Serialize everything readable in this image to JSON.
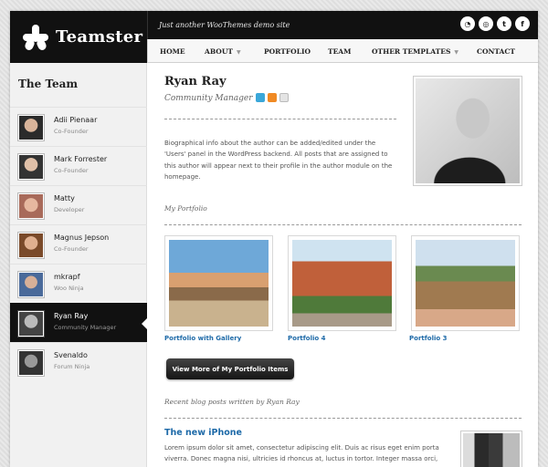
{
  "site": {
    "logo_text": "Teamster",
    "tagline": "Just another WooThemes demo site",
    "social": [
      {
        "icon": "rss-icon",
        "glyph": "◔"
      },
      {
        "icon": "dribbble-icon",
        "glyph": "◎"
      },
      {
        "icon": "twitter-icon",
        "glyph": "t"
      },
      {
        "icon": "facebook-icon",
        "glyph": "f"
      }
    ]
  },
  "nav": {
    "items": [
      {
        "label": "HOME"
      },
      {
        "label": "ABOUT",
        "has_submenu": true
      },
      {
        "label": "PORTFOLIO"
      },
      {
        "label": "TEAM"
      },
      {
        "label": "OTHER TEMPLATES",
        "has_submenu": true
      },
      {
        "label": "CONTACT"
      }
    ]
  },
  "sidebar": {
    "title": "The Team",
    "members": [
      {
        "name": "Adii Pienaar",
        "role": "Co-Founder"
      },
      {
        "name": "Mark Forrester",
        "role": "Co-Founder"
      },
      {
        "name": "Matty",
        "role": "Developer"
      },
      {
        "name": "Magnus Jepson",
        "role": "Co-Founder"
      },
      {
        "name": "mkrapf",
        "role": "Woo Ninja"
      },
      {
        "name": "Ryan Ray",
        "role": "Community Manager",
        "active": true
      },
      {
        "name": "Svenaldo",
        "role": "Forum Ninja"
      }
    ]
  },
  "author": {
    "name": "Ryan Ray",
    "role": "Community Manager",
    "bio": "Biographical info about the author can be added/edited under the 'Users' panel in the WordPress backend. All posts that are assigned to this author will appear next to their profile in the author module on the homepage."
  },
  "portfolio": {
    "label": "My Portfolio",
    "items": [
      {
        "caption": "Portfolio with Gallery"
      },
      {
        "caption": "Portfolio 4"
      },
      {
        "caption": "Portfolio 3"
      }
    ],
    "more_button": "View More of My Portfolio Items"
  },
  "posts": {
    "label": "Recent blog posts written by Ryan Ray",
    "latest": {
      "title": "The new iPhone",
      "excerpt": "Lorem ipsum dolor sit amet, consectetur adipiscing elit. Duis ac risus eget enim porta viverra. Donec magna nisi, ultricies id rhoncus at, luctus in tortor. Integer massa orci,"
    }
  },
  "colors": {
    "dark": "#111111",
    "link": "#1e6aa8",
    "twitter": "#3aa7d9",
    "rss": "#f08a24",
    "email": "#cfcfcf"
  }
}
